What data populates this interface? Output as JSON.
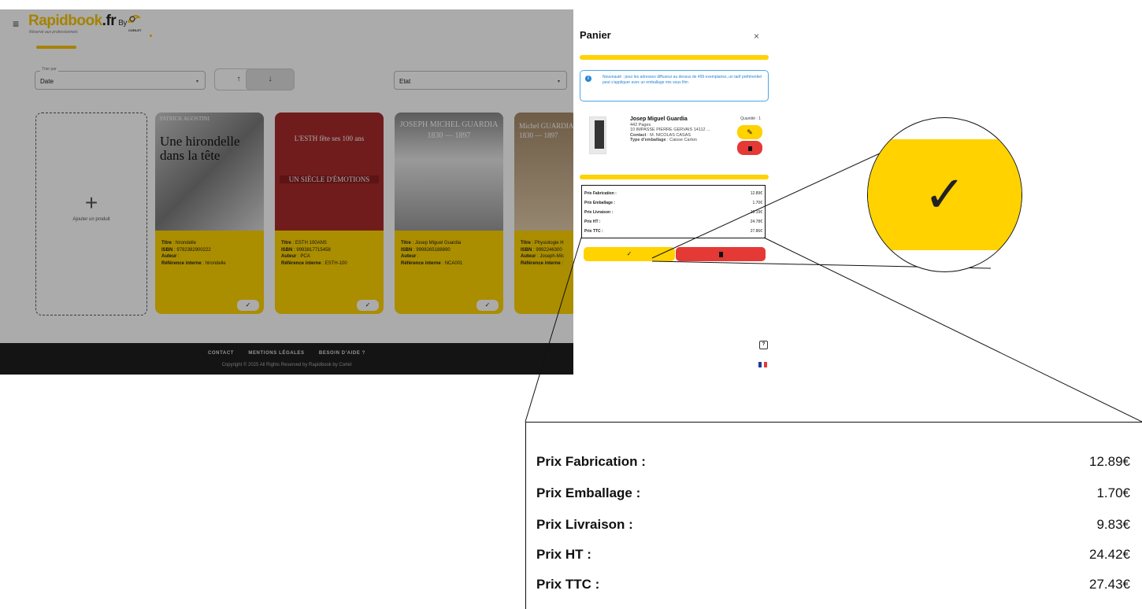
{
  "app": {
    "logo_main": "Rapidbook",
    "logo_suffix": ".fr",
    "logo_by": "By",
    "logo_subtitle": "Réservé aux professionnels",
    "logo_partner": "CORLET"
  },
  "filters": {
    "sort_label": "Trier par",
    "sort_value": "Date",
    "asc_icon": "↑",
    "desc_icon": "↓",
    "state_value": "Etat",
    "caret": "▾"
  },
  "add_card": {
    "icon": "+",
    "label": "Ajouter un produit"
  },
  "products": [
    {
      "cover_title": "Une hirondelle dans la tête",
      "cover_author": "PATRICK AGOSTINI",
      "title": "hirondelle",
      "isbn": "9792382900222",
      "author": "",
      "ref": "hirondelle",
      "check": "✓"
    },
    {
      "cover_title": "L'ESTH fête ses 100 ans",
      "cover_author": "UN SIÈCLE D'ÉMOTIONS",
      "title": "ESTH 100ANS",
      "isbn": "9993817715458",
      "author": "PCA",
      "ref": "ESTH-100",
      "check": "✓"
    },
    {
      "cover_title": "JOSEPH MICHEL GUARDIA",
      "cover_author": "1830 — 1897",
      "title": "Josep Miguel Guardia",
      "isbn": "9998265188890",
      "author": "",
      "ref": "NCA001",
      "check": "✓"
    },
    {
      "cover_title": "Michel GUARDIA",
      "cover_author": "1830 — 1897",
      "title": "Physiologie H",
      "isbn": "9992246300",
      "author": "Joseph-Mic",
      "ref": "",
      "check": "✓"
    }
  ],
  "labels": {
    "titre": "Titre",
    "isbn": "ISBN",
    "auteur": "Auteur",
    "ref": "Référence interne"
  },
  "footer": {
    "links": [
      "CONTACT",
      "MENTIONS LÉGALES",
      "BESOIN D'AIDE ?"
    ],
    "copyright": "Copyright © 2025 All Rights Reserved by Rapidbook by Corlet"
  },
  "cart": {
    "title": "Panier",
    "close": "×",
    "notice_icon": "i",
    "notice": "Nouveauté : pour les adresses diffuseur au dessus de 499 exemplaires, un tarif préférentiel peut s'appliquer avec un emballage mis sous film",
    "item": {
      "name": "Josep Miguel Guardia",
      "pages": "442 Pages",
      "address": "10 IMPASSE PIERRE GERVAIS 14112 ...",
      "contact_label": "Contact",
      "contact": "M. NICOLAS CASAS",
      "packaging_label": "Type d'emballage",
      "packaging": "Caisse Carton",
      "quantity": "Quantité : 1",
      "edit_icon": "✎"
    },
    "prices": [
      {
        "label": "Prix Fabrication :",
        "value": "12.89€"
      },
      {
        "label": "Prix Emballage :",
        "value": "1.70€"
      },
      {
        "label": "Prix Livraison :",
        "value": "10.19€"
      },
      {
        "label": "Prix HT :",
        "value": "24.78€"
      },
      {
        "label": "Prix TTC :",
        "value": "27.86€"
      }
    ],
    "validate_icon": "✓",
    "help_icon": "?"
  },
  "zoom_check": {
    "icon": "✓"
  },
  "zoom_prices": [
    {
      "label": "Prix Fabrication :",
      "value": "12.89€"
    },
    {
      "label": "Prix Emballage :",
      "value": "1.70€"
    },
    {
      "label": "Prix Livraison :",
      "value": "9.83€"
    },
    {
      "label": "Prix HT :",
      "value": "24.42€"
    },
    {
      "label": "Prix TTC :",
      "value": "27.43€"
    }
  ],
  "colors": {
    "accent": "#ffd200",
    "danger": "#e53935",
    "info": "#2684d6",
    "footer": "#1f1f1f"
  }
}
